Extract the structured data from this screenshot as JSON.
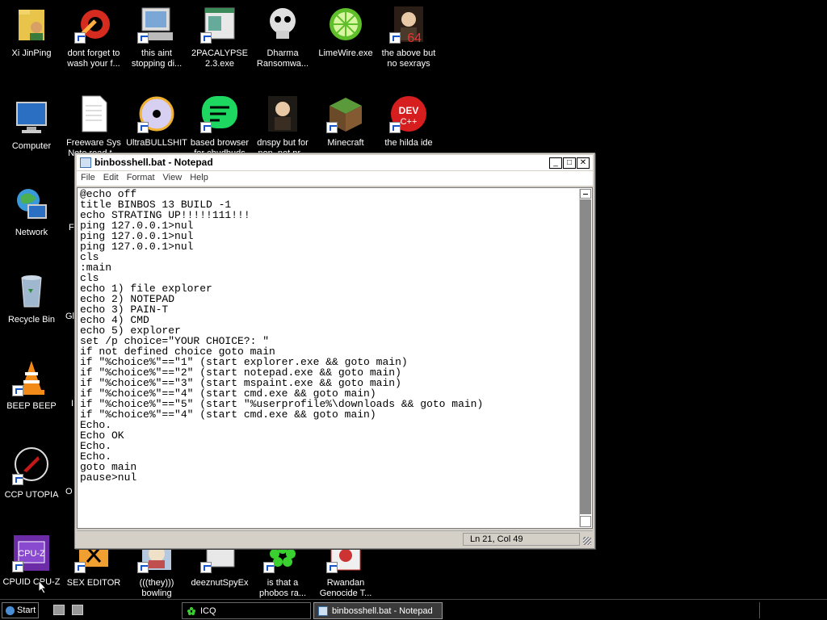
{
  "desktop": {
    "icons": [
      {
        "label": "Xi JinPing"
      },
      {
        "label": "dont forget to\nwash your f..."
      },
      {
        "label": "this aint\nstopping di..."
      },
      {
        "label": "2PACALYPSE\n2.3.exe"
      },
      {
        "label": "Dharma\nRansomwa..."
      },
      {
        "label": "LimeWire.exe"
      },
      {
        "label": "the above but\nno sexrays"
      },
      {
        "label": "Computer"
      },
      {
        "label": "Freeware Sys\nNote read t..."
      },
      {
        "label": "UltraBULLSHIT"
      },
      {
        "label": "based browser\nfor chudbuds"
      },
      {
        "label": "dnspy but for\nnon .net pr..."
      },
      {
        "label": "Minecraft"
      },
      {
        "label": "the hilda ide"
      },
      {
        "label": "Network"
      },
      {
        "label": "Recycle Bin"
      },
      {
        "label": "BEEP BEEP"
      },
      {
        "label": "CCP UTOPIA"
      },
      {
        "label": "CPUID CPU-Z"
      },
      {
        "label": "SEX EDITOR"
      },
      {
        "label": "(((they)))\nbowling"
      },
      {
        "label": "deeznutSpyEx"
      },
      {
        "label": "is that a\nphobos ra..."
      },
      {
        "label": "Rwandan\nGenocide T..."
      }
    ],
    "partial_labels": [
      "F",
      "Gl",
      "I",
      "O"
    ]
  },
  "notepad": {
    "title": "binbosshell.bat - Notepad",
    "menu": [
      "File",
      "Edit",
      "Format",
      "View",
      "Help"
    ],
    "content": "@echo off\ntitle BINBOS 13 BUILD -1\necho STRATING UP!!!!!111!!!\nping 127.0.0.1>nul\nping 127.0.0.1>nul\nping 127.0.0.1>nul\ncls\n:main\ncls\necho 1) file explorer\necho 2) NOTEPAD\necho 3) PAIN-T\necho 4) CMD\necho 5) explorer\nset /p choice=\"YOUR CHOICE?: \"\nif not defined choice goto main\nif \"%choice%\"==\"1\" (start explorer.exe && goto main)\nif \"%choice%\"==\"2\" (start notepad.exe && goto main)\nif \"%choice%\"==\"3\" (start mspaint.exe && goto main)\nif \"%choice%\"==\"4\" (start cmd.exe && goto main)\nif \"%choice%\"==\"5\" (start \"%userprofile%\\downloads && goto main)\nif \"%choice%\"==\"4\" (start cmd.exe && goto main)\nEcho.\nEcho OK\nEcho.\nEcho.\ngoto main\npause>nul",
    "status": "Ln 21, Col 49",
    "buttons": {
      "minimize": "_",
      "maximize": "□",
      "close": "✕"
    }
  },
  "taskbar": {
    "start_label": "Start",
    "tasks": [
      {
        "label": "ICQ",
        "active": false
      },
      {
        "label": "binbosshell.bat - Notepad",
        "active": true
      }
    ]
  },
  "icon_names": [
    "folder-user-icon",
    "ccleaner-icon",
    "computer-tools-icon",
    "program-icon",
    "skull-icon",
    "limewire-icon",
    "portrait-icon",
    "computer-icon",
    "text-document-icon",
    "cd-icon",
    "spotify-icon",
    "portrait-icon",
    "minecraft-icon",
    "devcpp-icon",
    "network-icon",
    "recycle-bin-icon",
    "vlc-icon",
    "ccp-icon",
    "cpuz-icon",
    "editor-icon",
    "bowling-icon",
    "program-icon",
    "icq-icon",
    "portrait-icon"
  ]
}
